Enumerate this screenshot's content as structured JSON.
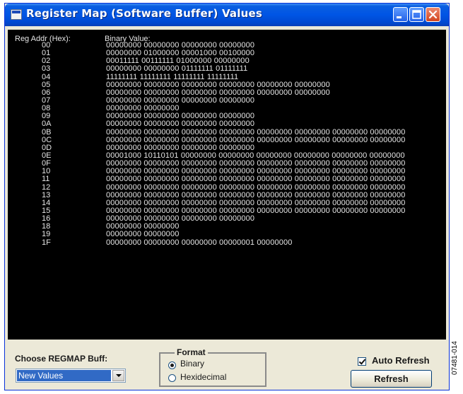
{
  "window": {
    "title": "Register Map (Software Buffer) Values"
  },
  "icons": {
    "app": "app-window-icon",
    "minimize": "minimize-icon",
    "maximize": "maximize-icon",
    "close": "close-icon",
    "dropdown": "chevron-down-icon"
  },
  "colors": {
    "titlebar": "#0055e5",
    "screen_bg": "#000000",
    "screen_text": "#e6e6e6",
    "selection": "#316ac5",
    "close_button": "#d2451f"
  },
  "register_table": {
    "addr_header": "Reg Addr (Hex):",
    "value_header": "Binary Value:",
    "rows": [
      {
        "addr": "00",
        "value": "00000000 00000000 00000000 00000000"
      },
      {
        "addr": "01",
        "value": "00000000 01000000 00001000 00100000"
      },
      {
        "addr": "02",
        "value": "00011111 00111111 01000000 00000000"
      },
      {
        "addr": "03",
        "value": "00000000 00000000 01111111 01111111"
      },
      {
        "addr": "04",
        "value": "11111111 11111111 11111111 11111111"
      },
      {
        "addr": "05",
        "value": "00000000 00000000 00000000 00000000 00000000 00000000"
      },
      {
        "addr": "06",
        "value": "00000000 00000000 00000000 00000000 00000000 00000000"
      },
      {
        "addr": "07",
        "value": "00000000 00000000 00000000 00000000"
      },
      {
        "addr": "08",
        "value": "00000000 00000000"
      },
      {
        "addr": "09",
        "value": "00000000 00000000 00000000 00000000"
      },
      {
        "addr": "0A",
        "value": "00000000 00000000 00000000 00000000"
      },
      {
        "addr": "0B",
        "value": "00000000 00000000 00000000 00000000 00000000 00000000 00000000 00000000"
      },
      {
        "addr": "0C",
        "value": "00000000 00000000 00000000 00000000 00000000 00000000 00000000 00000000"
      },
      {
        "addr": "0D",
        "value": "00000000 00000000 00000000 00000000"
      },
      {
        "addr": "0E",
        "value": "00001000 10110101 00000000 00000000 00000000 00000000 00000000 00000000"
      },
      {
        "addr": "0F",
        "value": "00000000 00000000 00000000 00000000 00000000 00000000 00000000 00000000"
      },
      {
        "addr": "10",
        "value": "00000000 00000000 00000000 00000000 00000000 00000000 00000000 00000000"
      },
      {
        "addr": "11",
        "value": "00000000 00000000 00000000 00000000 00000000 00000000 00000000 00000000"
      },
      {
        "addr": "12",
        "value": "00000000 00000000 00000000 00000000 00000000 00000000 00000000 00000000"
      },
      {
        "addr": "13",
        "value": "00000000 00000000 00000000 00000000 00000000 00000000 00000000 00000000"
      },
      {
        "addr": "14",
        "value": "00000000 00000000 00000000 00000000 00000000 00000000 00000000 00000000"
      },
      {
        "addr": "15",
        "value": "00000000 00000000 00000000 00000000 00000000 00000000 00000000 00000000"
      },
      {
        "addr": "16",
        "value": "00000000 00000000 00000000 00000000"
      },
      {
        "addr": "18",
        "value": "00000000 00000000"
      },
      {
        "addr": "19",
        "value": "00000000 00000000"
      },
      {
        "addr": "1F",
        "value": "00000000 00000000 00000000 00000001 00000000"
      }
    ]
  },
  "controls": {
    "choose_label": "Choose REGMAP Buff:",
    "buffer_select_value": "New Values",
    "format_legend": "Format",
    "format_options": [
      {
        "label": "Binary",
        "checked": true
      },
      {
        "label": "Hexidecimal",
        "checked": false
      }
    ],
    "auto_refresh_label": "Auto Refresh",
    "auto_refresh_checked": true,
    "refresh_label": "Refresh"
  },
  "figure_id": "07481-014"
}
